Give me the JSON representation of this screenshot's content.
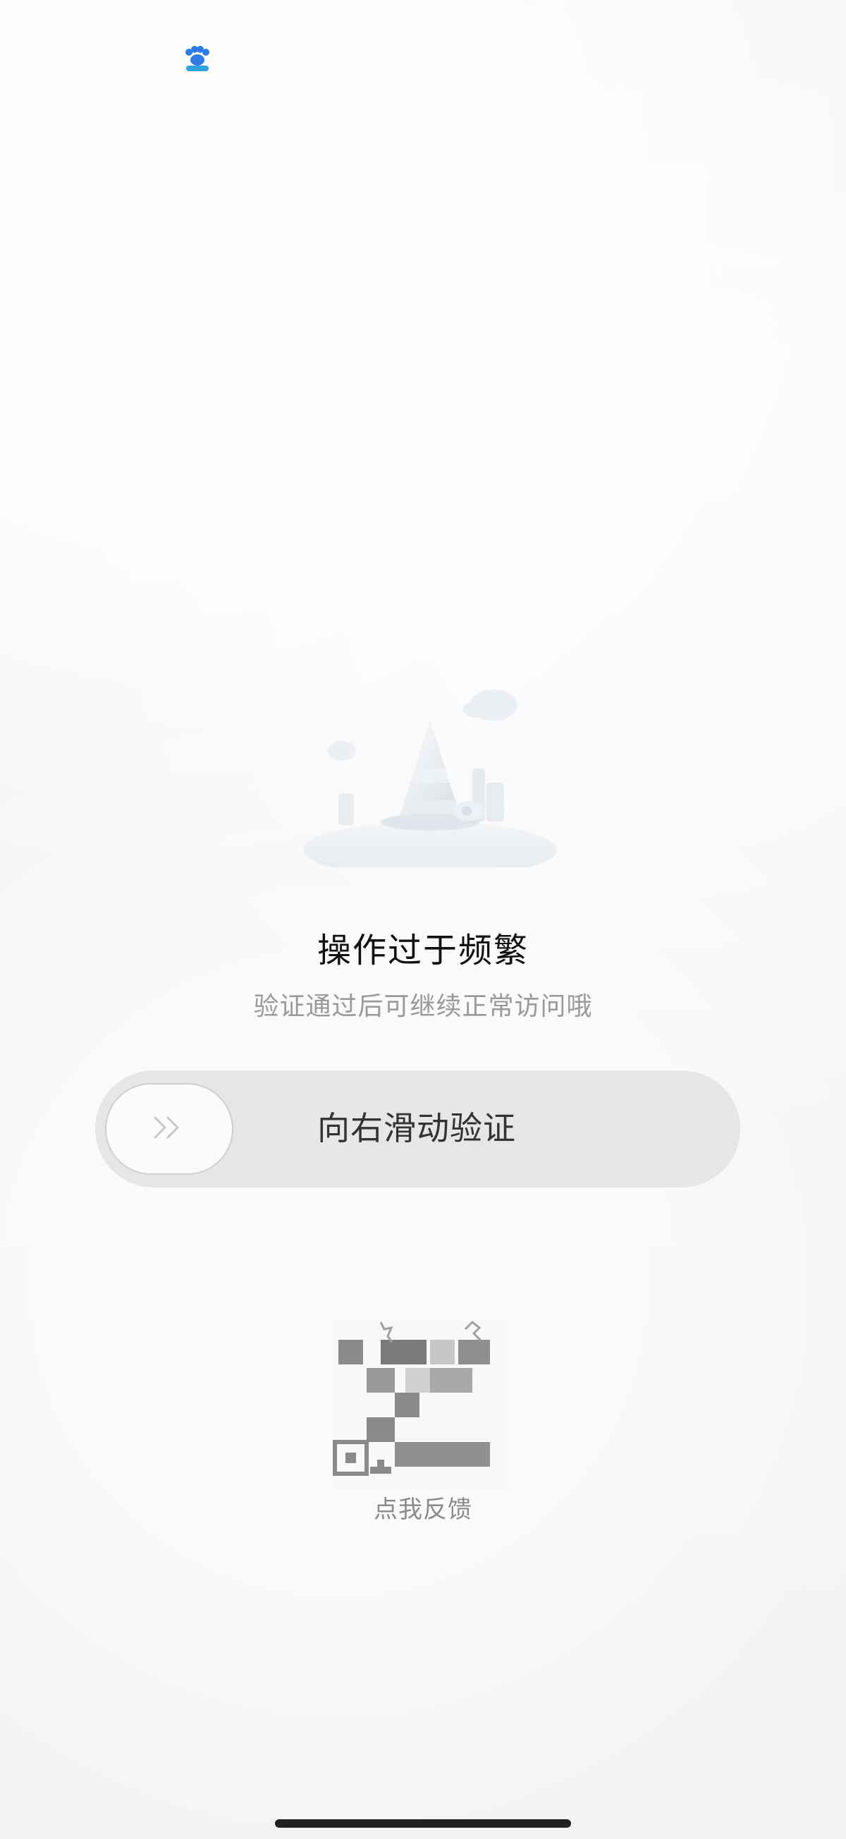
{
  "title": "操作过于频繁",
  "subtitle": "验证通过后可继续正常访问哦",
  "slider": {
    "label": "向右滑动验证",
    "handle_icon": "double-chevron-right-icon"
  },
  "feedback_label": "点我反馈",
  "colors": {
    "background": "#f6f6f6",
    "track": "#e6e6e6",
    "title": "#111111",
    "subtitle": "#999999"
  },
  "icons": {
    "logo": "baidu-paw-logo-icon",
    "illustration": "traffic-cone-cloud-illustration-icon",
    "qr": "qr-code-icon"
  }
}
